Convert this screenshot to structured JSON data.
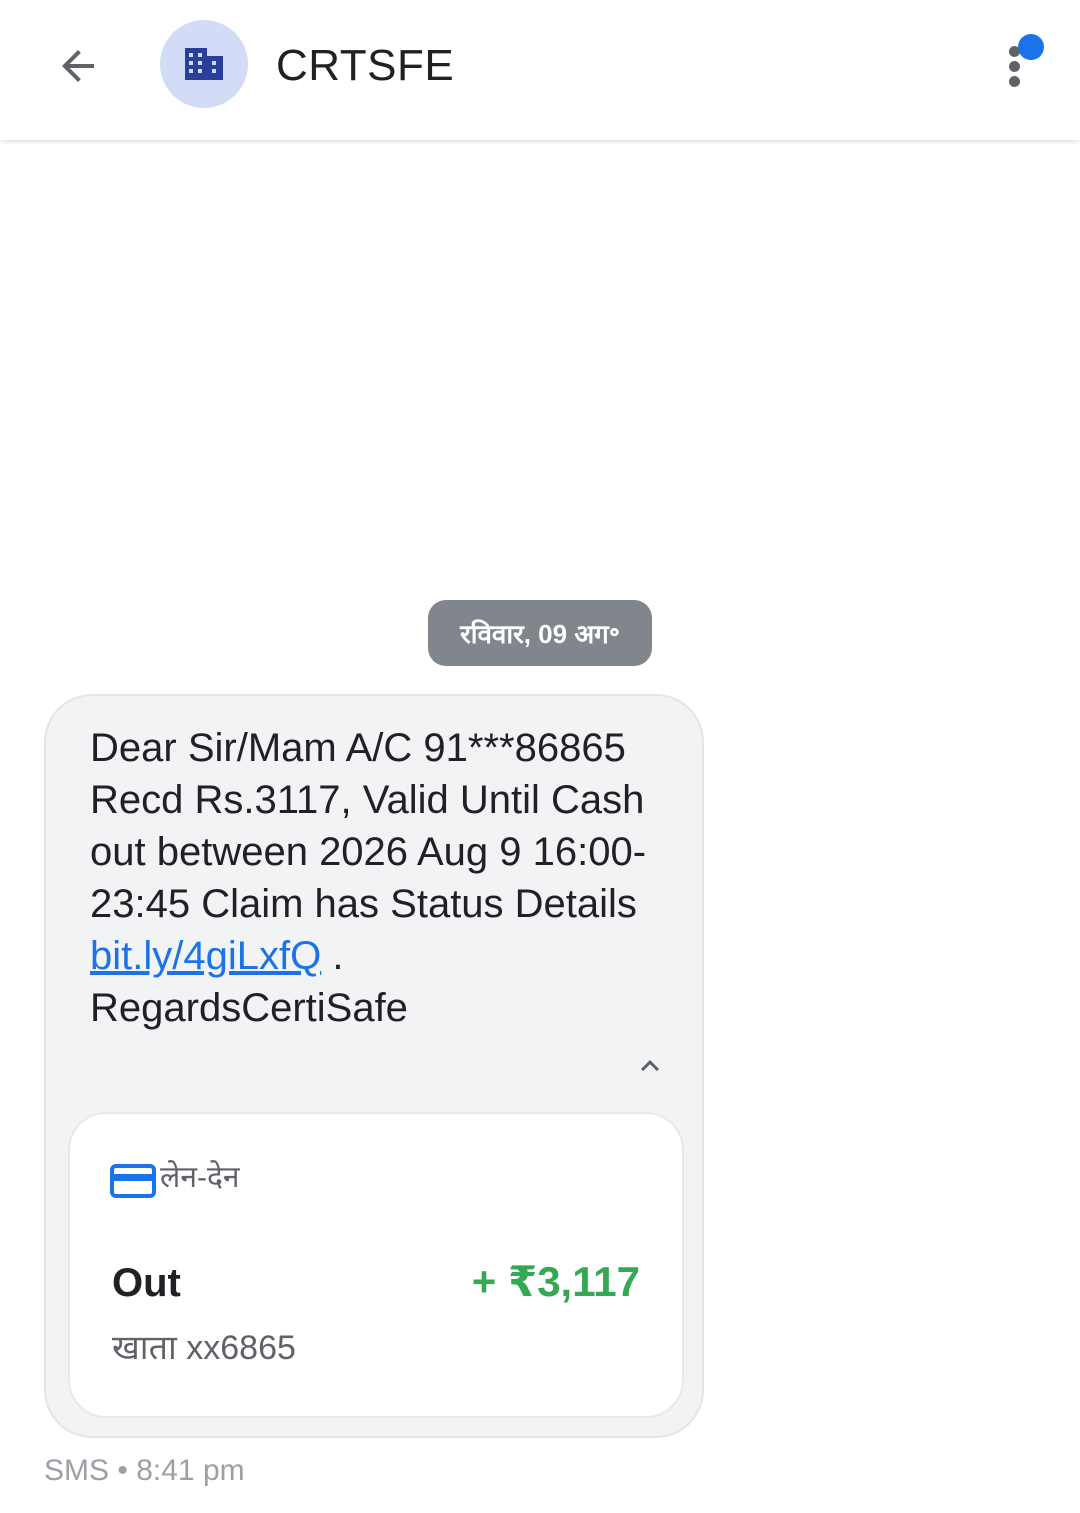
{
  "header": {
    "contact_name": "CRTSFE",
    "back_icon": "arrow-back-icon",
    "avatar_icon": "business-building-icon",
    "more_icon": "more-vert-icon",
    "colors": {
      "avatar_bg": "#d3dcf7",
      "avatar_icon": "#2a3f9d",
      "notification_dot": "#1a73e8"
    }
  },
  "date_chip": {
    "label": "रविवार, 09 अग॰"
  },
  "message": {
    "text_before_link": "Dear Sir/Mam A/C 91***86865 Recd Rs.3117, Valid Until Cash out between 2026 Aug 9 16:00-23:45 Claim has Status Details ",
    "link": "bit.ly/4giLxfQ",
    "text_after_link": " . RegardsCertiSafe",
    "collapse_icon": "chevron-up-icon"
  },
  "transaction_card": {
    "label": "लेन-देन",
    "icon": "credit-card-icon",
    "type": "Out",
    "amount": "+ ₹3,117",
    "account": "खाता xx6865",
    "colors": {
      "amount": "#34a853",
      "card_icon": "#1a73e8"
    }
  },
  "meta": {
    "channel": "SMS",
    "separator": "•",
    "time": "8:41 pm"
  }
}
